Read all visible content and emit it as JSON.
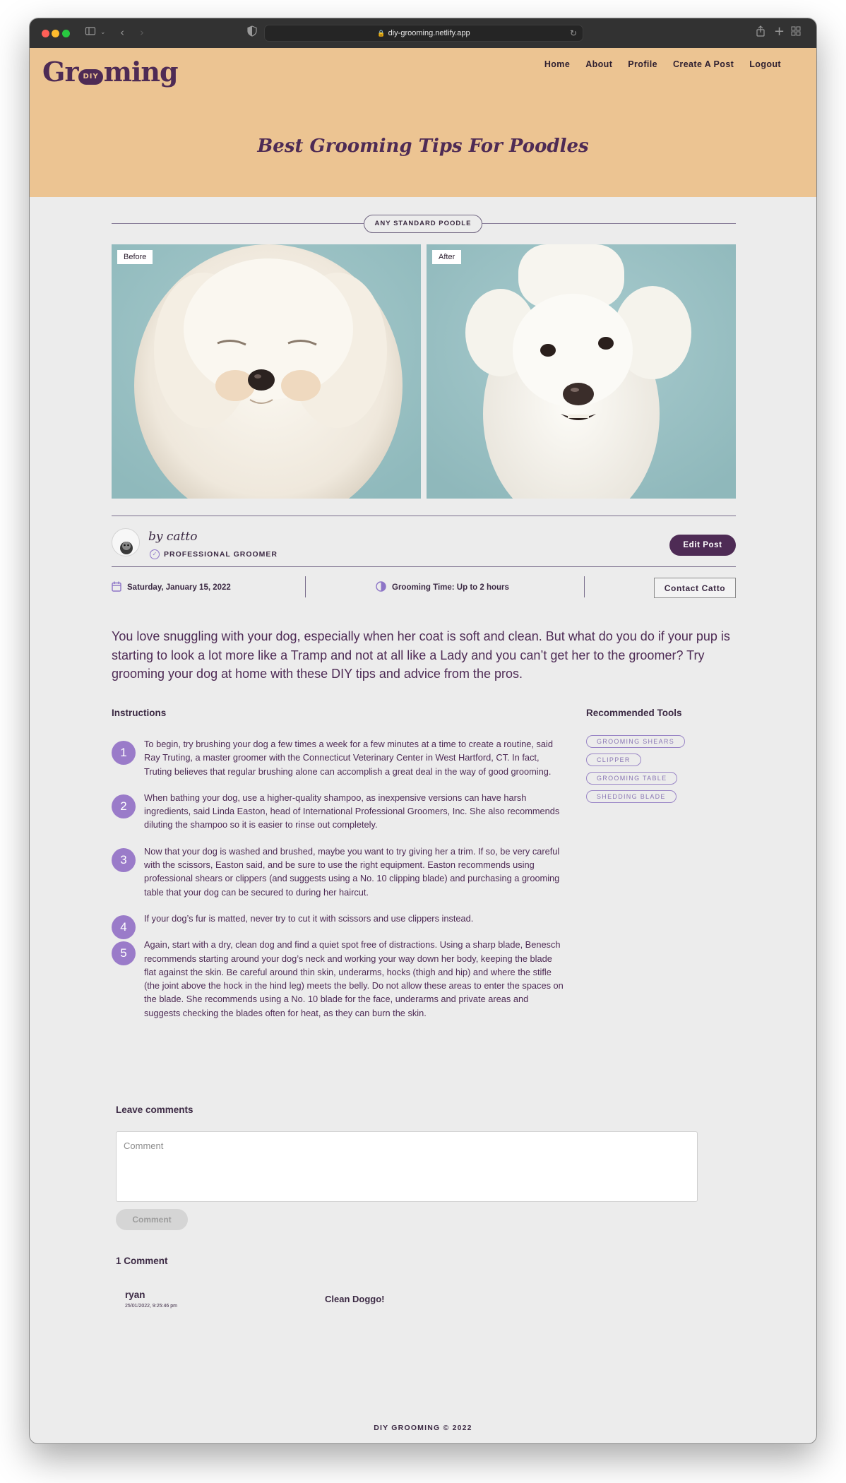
{
  "browser": {
    "url": "diy-grooming.netlify.app"
  },
  "site": {
    "logo_left": "Gr",
    "logo_badge": "DIY",
    "logo_right": "ming",
    "nav": [
      {
        "label": "Home"
      },
      {
        "label": "About"
      },
      {
        "label": "Profile"
      },
      {
        "label": "Create A Post"
      },
      {
        "label": "Logout"
      }
    ]
  },
  "post": {
    "title": "Best Grooming Tips For Poodles",
    "breed": "ANY STANDARD POODLE",
    "before_label": "Before",
    "after_label": "After",
    "author_byline": "by catto",
    "author_role": "PROFESSIONAL GROOMER",
    "edit_label": "Edit Post",
    "date": "Saturday, January 15, 2022",
    "grooming_time": "Grooming Time: Up to 2 hours",
    "contact_label": "Contact Catto",
    "intro": "You love snuggling with your dog, especially when her coat is soft and clean. But what do you do if your pup is starting to look a lot more like a Tramp and not at all like a Lady and you can’t get her to the groomer? Try grooming your dog at home with these DIY tips and advice from the pros.",
    "instructions_title": "Instructions",
    "steps": [
      {
        "num": "1",
        "text": "To begin, try brushing your dog a few times a week for a few minutes at a time to create a routine, said Ray Truting, a master groomer with the Connecticut Veterinary Center in West Hartford, CT. In fact, Truting believes that regular brushing alone can accomplish a great deal in the way of good grooming."
      },
      {
        "num": "2",
        "text": "When bathing your dog, use a higher-quality shampoo, as inexpensive versions can have harsh ingredients, said Linda Easton, head of International Professional Groomers, Inc. She also recommends diluting the shampoo so it is easier to rinse out completely."
      },
      {
        "num": "3",
        "text": "Now that your dog is washed and brushed, maybe you want to try giving her a trim. If so, be very careful with the scissors, Easton said, and be sure to use the right equipment. Easton recommends using professional shears or clippers (and suggests using a No. 10 clipping blade) and purchasing a grooming table that your dog can be secured to during her haircut."
      },
      {
        "num": "4",
        "text": "If your dog’s fur is matted, never try to cut it with scissors and use clippers instead."
      },
      {
        "num": "5",
        "text": "Again, start with a dry, clean dog and find a quiet spot free of distractions. Using a sharp blade, Benesch recommends starting around your dog’s neck and working your way down her body, keeping the blade flat against the skin. Be careful around thin skin, underarms, hocks (thigh and hip) and where the stifle (the joint above the hock in the hind leg) meets the belly. Do not allow these areas to enter the spaces on the blade. She recommends using a No. 10 blade for the face, underarms and private areas and suggests checking the blades often for heat, as they can burn the skin."
      }
    ],
    "tools_title": "Recommended Tools",
    "tools": [
      "GROOMING SHEARS",
      "CLIPPER",
      "GROOMING TABLE",
      "SHEDDING BLADE"
    ]
  },
  "comments": {
    "title": "Leave comments",
    "placeholder": "Comment",
    "submit_label": "Comment",
    "count_label": "1 Comment",
    "items": [
      {
        "author": "ryan",
        "time": "25/01/2022, 9:25:46 pm",
        "body": "Clean Doggo!"
      }
    ]
  },
  "footer": {
    "text": "DIY GROOMING © 2022"
  },
  "colors": {
    "brand": "#4e2b55",
    "hero_bg": "#ecc492",
    "accent": "#9a7bc9"
  }
}
